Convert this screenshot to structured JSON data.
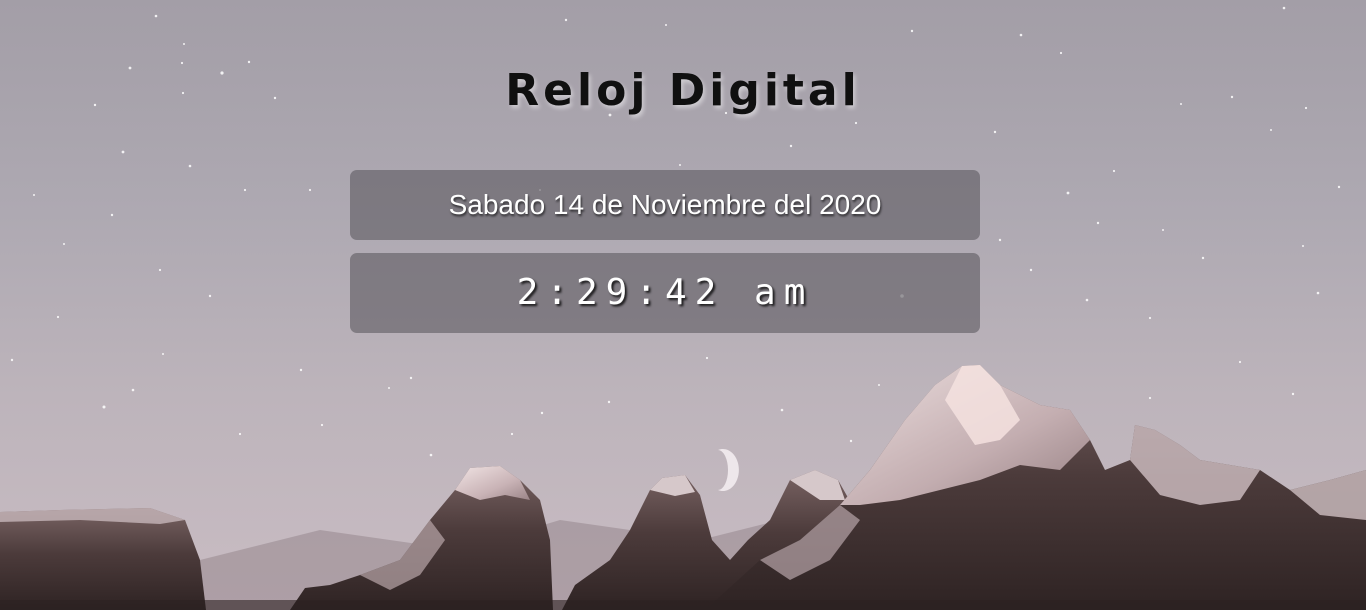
{
  "page": {
    "title": "Reloj Digital"
  },
  "clock": {
    "date_text": "Sabado 14 de Noviembre del 2020",
    "time_text": "2:29:42 am"
  },
  "background": {
    "image": "mountain-night-sky",
    "sky_color": "#aea9b2",
    "mountain_color": "#4a3a3a",
    "snow_color": "#d8cdd0"
  }
}
